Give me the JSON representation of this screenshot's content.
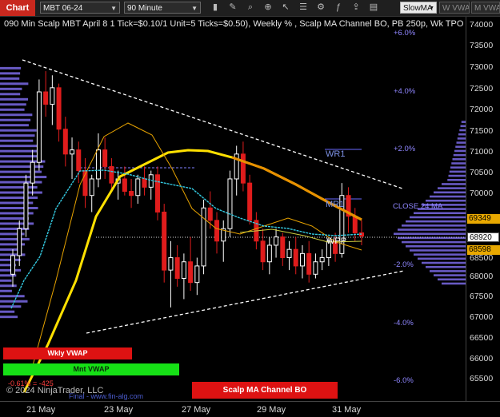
{
  "toolbar": {
    "chart_tab": "Chart",
    "instrument": "MBT 06-24",
    "interval": "90 Minute",
    "buttons": [
      "bar-style-icon",
      "drawing-tools-icon",
      "magnify-icon",
      "zoom-icon",
      "pointer-icon",
      "properties-icon",
      "strategies-icon",
      "indicators-icon",
      "share-icon",
      "templates-icon"
    ],
    "slowma_select": "SlowMA",
    "w_vwap_label": "W VWAP",
    "m_vwap_label": "M VWAP"
  },
  "chart": {
    "title": "090 Min Scalp MBT April 8 1 Tick=$0.10/1 Unit=5 Ticks=$0.50), Weekly % , Scalp MA Channel BO, PB 250p, Wk TPO",
    "copyright": "© 2024 NinjaTrader, LLC",
    "footer_text": "Final - www.fin-alg.com",
    "pct_levels": [
      "+6.0%",
      "+4.0%",
      "+2.0%",
      "-2.0%",
      "-4.0%",
      "-6.0%"
    ],
    "levels": {
      "wr1": "WR1",
      "mr1": "MR1",
      "wpp": "WPP",
      "close": "CLOSE 24 MA"
    },
    "small_red_text": "-0.61% = -425",
    "boxes": {
      "wkly": "Wkly VWAP",
      "mnt": "Mnt VWAP",
      "scalp": "Scalp MA Channel BO"
    },
    "price_tags": {
      "upper": "69349",
      "current": "68920",
      "lower": "68598"
    }
  },
  "y_axis": {
    "labels": [
      "74000",
      "73500",
      "73000",
      "72500",
      "72000",
      "71500",
      "71000",
      "70500",
      "70000",
      "69500",
      "69000",
      "68500",
      "68000",
      "67500",
      "67000",
      "66500",
      "66000",
      "65500"
    ]
  },
  "x_axis": {
    "labels": [
      "21 May",
      "23 May",
      "27 May",
      "29 May",
      "31 May"
    ]
  },
  "chart_data": {
    "type": "candlestick",
    "title": "090 Min Scalp MBT April 8 1 Tick=$0.10/1 Unit=5 Ticks=$0.50), Weekly % , Scalp MA Channel BO, PB 250p, Wk TPO",
    "x_labels": [
      "21 May",
      "23 May",
      "27 May",
      "29 May",
      "31 May"
    ],
    "ylim": [
      65250,
      74100
    ],
    "y_ticks": [
      74000,
      73500,
      73000,
      72500,
      72000,
      71500,
      71000,
      70500,
      70000,
      69500,
      69000,
      68500,
      68000,
      67500,
      67000,
      66500,
      66000,
      65500
    ],
    "last_price": 68920,
    "levels": {
      "WR1": 71000,
      "MR1": 69800,
      "WPP": 68850,
      "CLOSE 24 MA": 69450,
      "+6.0%": 74000,
      "+4.0%": 72600,
      "+2.0%": 71100,
      "-2.0%": 68200,
      "-4.0%": 66800,
      "-6.0%": 65500
    },
    "ohlc": [
      [
        68000,
        68600,
        67700,
        68450
      ],
      [
        68450,
        69300,
        68200,
        69100
      ],
      [
        69100,
        70400,
        68900,
        70200
      ],
      [
        70200,
        71000,
        69900,
        70700
      ],
      [
        70700,
        72700,
        70500,
        72400
      ],
      [
        72400,
        72900,
        71800,
        72100
      ],
      [
        72100,
        72800,
        71600,
        72500
      ],
      [
        72500,
        72600,
        71200,
        71500
      ],
      [
        71500,
        71800,
        70600,
        70900
      ],
      [
        70900,
        71300,
        70300,
        71000
      ],
      [
        71000,
        71200,
        70200,
        70500
      ],
      [
        70500,
        70800,
        69600,
        69900
      ],
      [
        69900,
        70400,
        69500,
        70300
      ],
      [
        70300,
        71400,
        70100,
        71000
      ],
      [
        71000,
        71300,
        70300,
        70600
      ],
      [
        70600,
        70800,
        70000,
        70200
      ],
      [
        70200,
        70500,
        69800,
        70300
      ],
      [
        70300,
        70600,
        69900,
        70000
      ],
      [
        70000,
        70300,
        69600,
        69900
      ],
      [
        69900,
        70400,
        69700,
        70300
      ],
      [
        70300,
        70600,
        69900,
        70100
      ],
      [
        70100,
        70500,
        69800,
        70400
      ],
      [
        70400,
        70600,
        69300,
        69500
      ],
      [
        69500,
        69700,
        67800,
        68100
      ],
      [
        68100,
        68800,
        67200,
        68400
      ],
      [
        68400,
        68700,
        67700,
        67900
      ],
      [
        67900,
        68500,
        67400,
        68300
      ],
      [
        68300,
        68900,
        67600,
        67800
      ],
      [
        67800,
        68400,
        67500,
        68200
      ],
      [
        68200,
        69800,
        68000,
        69600
      ],
      [
        69600,
        70000,
        69100,
        69300
      ],
      [
        69300,
        69500,
        68500,
        68800
      ],
      [
        68800,
        69300,
        68300,
        69100
      ],
      [
        69100,
        70500,
        68900,
        70300
      ],
      [
        70300,
        71100,
        69900,
        70900
      ],
      [
        70900,
        71200,
        70000,
        70200
      ],
      [
        70200,
        70400,
        69200,
        69300
      ],
      [
        69300,
        69500,
        68600,
        68800
      ],
      [
        68800,
        69100,
        68100,
        68300
      ],
      [
        68300,
        68900,
        68000,
        68700
      ],
      [
        68700,
        69100,
        68400,
        68900
      ],
      [
        68900,
        69000,
        68200,
        68400
      ],
      [
        68400,
        68800,
        68100,
        68600
      ],
      [
        68600,
        68900,
        68000,
        68200
      ],
      [
        68200,
        68700,
        67900,
        68500
      ],
      [
        68500,
        68800,
        67800,
        68000
      ],
      [
        68000,
        68500,
        67900,
        68300
      ],
      [
        68300,
        68600,
        68100,
        68400
      ],
      [
        68400,
        68900,
        68200,
        68800
      ],
      [
        68800,
        69000,
        68300,
        68500
      ],
      [
        68500,
        70200,
        68400,
        69900
      ],
      [
        69900,
        70100,
        69000,
        69400
      ],
      [
        69400,
        69600,
        68800,
        69000
      ],
      [
        69000,
        69300,
        68700,
        68920
      ]
    ],
    "series": [
      {
        "name": "Wkly VWAP",
        "color": "#e01c1c"
      },
      {
        "name": "Mnt VWAP",
        "color": "#22dd22"
      },
      {
        "name": "Scalp MA Channel BO",
        "color": "#e01c1c"
      }
    ],
    "colors": {
      "up": "#ffffff",
      "down": "#e01c1c",
      "slow_ma": "#ffe000",
      "fast_ma": "#e6a200",
      "vwap": "#34c9e0",
      "profile": "#7a6ae6"
    }
  }
}
